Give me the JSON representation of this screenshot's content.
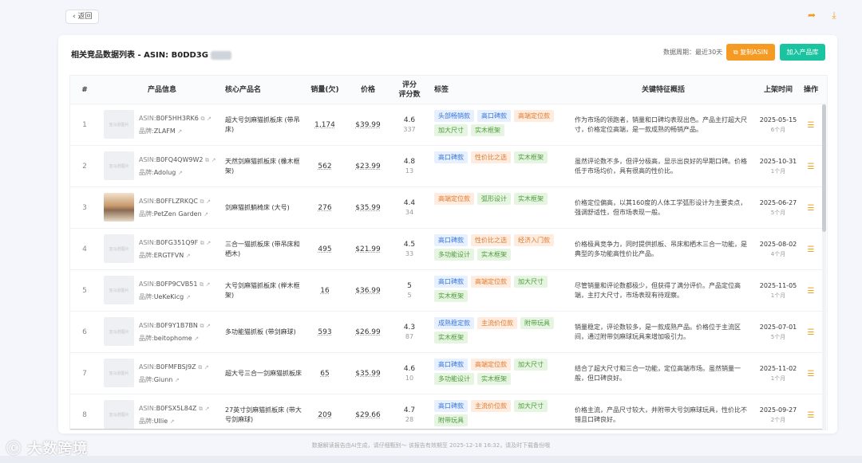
{
  "topbar": {
    "back_label": "返回",
    "share_icon": "share-arrow-icon",
    "download_icon": "download-icon"
  },
  "card": {
    "title": "相关竞品数据列表 - ASIN: B0DD3G",
    "period": "数据周期：最近30天",
    "copy_button": "复制ASIN",
    "add_button": "加入产品库"
  },
  "table": {
    "headers": {
      "index": "#",
      "product": "产品信息",
      "name": "核心产品名",
      "sales": "销量(欠)",
      "price": "价格",
      "score_line1": "评分",
      "score_line2": "评分数",
      "tags": "标签",
      "features": "关键特征概括",
      "date": "上架时间",
      "op": "操作"
    },
    "asin_prefix": "ASIN:",
    "brand_prefix": "品牌:",
    "thumb_placeholder": "亚马逊图片",
    "rows": [
      {
        "idx": "1",
        "asin": "B0F5HH3RK6",
        "brand": "ZLAFM",
        "name": "超大号剑麻猫抓板床 (带吊床)",
        "sales": "1,174",
        "price": "$39.99",
        "score": "4.6",
        "count": "337",
        "tags": [
          {
            "t": "头部畅销款",
            "c": "blue"
          },
          {
            "t": "高口碑款",
            "c": "blue"
          },
          {
            "t": "高端定位款",
            "c": "orange"
          },
          {
            "t": "加大尺寸",
            "c": "green"
          },
          {
            "t": "实木框架",
            "c": "green"
          }
        ],
        "feature": "作为市场的领跑者，销量和口碑均表现出色。产品主打超大尺寸，价格定位高端，是一款成熟的畅销产品。",
        "date": "2025-05-15",
        "ago": "6个月",
        "photo": false
      },
      {
        "idx": "2",
        "asin": "B0FQ4QW9W2",
        "brand": "Adolug",
        "name": "天然剑麻猫抓板床 (橡木框架)",
        "sales": "562",
        "price": "$23.99",
        "score": "4.8",
        "count": "13",
        "tags": [
          {
            "t": "高口碑款",
            "c": "blue"
          },
          {
            "t": "性价比之选",
            "c": "orange"
          },
          {
            "t": "实木框架",
            "c": "green"
          }
        ],
        "feature": "虽然评论数不多，但评分极高，显示出良好的早期口碑。价格低于市场均价，具有很高的性价比。",
        "date": "2025-10-31",
        "ago": "1个月",
        "photo": false
      },
      {
        "idx": "3",
        "asin": "B0FFLZRKQC",
        "brand": "PetZen Garden",
        "name": "剑麻猫抓躺椅床 (大号)",
        "sales": "276",
        "price": "$35.99",
        "score": "4.4",
        "count": "34",
        "tags": [
          {
            "t": "高端定位款",
            "c": "orange"
          },
          {
            "t": "弧形设计",
            "c": "green"
          },
          {
            "t": "实木框架",
            "c": "green"
          }
        ],
        "feature": "价格定位偏高，以其160度的人体工学弧形设计为主要卖点，强调舒适性，但市场表现一般。",
        "date": "2025-06-27",
        "ago": "5个月",
        "photo": true
      },
      {
        "idx": "4",
        "asin": "B0FG351Q9F",
        "brand": "ERGTFVN",
        "name": "三合一猫抓板床 (带吊床和栖木)",
        "sales": "495",
        "price": "$21.99",
        "score": "4.5",
        "count": "33",
        "tags": [
          {
            "t": "高口碑款",
            "c": "blue"
          },
          {
            "t": "性价比之选",
            "c": "orange"
          },
          {
            "t": "经济入门款",
            "c": "orange"
          },
          {
            "t": "多功能设计",
            "c": "green"
          },
          {
            "t": "实木框架",
            "c": "green"
          }
        ],
        "feature": "价格极具竞争力，同时提供抓板、吊床和栖木三合一功能，是典型的多功能高性价比产品。",
        "date": "2025-08-02",
        "ago": "4个月",
        "photo": false
      },
      {
        "idx": "5",
        "asin": "B0FP9CVB51",
        "brand": "UeKeKicg",
        "name": "大号剑麻猫抓板床 (榉木框架)",
        "sales": "16",
        "price": "$36.99",
        "score": "5",
        "count": "5",
        "tags": [
          {
            "t": "高口碑款",
            "c": "blue"
          },
          {
            "t": "高端定位款",
            "c": "orange"
          },
          {
            "t": "加大尺寸",
            "c": "green"
          },
          {
            "t": "实木框架",
            "c": "green"
          }
        ],
        "feature": "尽管销量和评论数都极少，但获得了满分评价。产品定位高端，主打大尺寸，市场表现有待观察。",
        "date": "2025-11-05",
        "ago": "1个月",
        "photo": false
      },
      {
        "idx": "6",
        "asin": "B0F9Y1B7BN",
        "brand": "beitophome",
        "name": "多功能猫抓板 (带剑麻球)",
        "sales": "593",
        "price": "$26.99",
        "score": "4.3",
        "count": "87",
        "tags": [
          {
            "t": "成熟稳定款",
            "c": "blue"
          },
          {
            "t": "主流价位款",
            "c": "orange"
          },
          {
            "t": "附带玩具",
            "c": "green"
          },
          {
            "t": "实木框架",
            "c": "green"
          }
        ],
        "feature": "销量稳定，评论数较多，是一款成熟产品。价格位于主流区间，通过附带剑麻球玩具来增加吸引力。",
        "date": "2025-07-01",
        "ago": "5个月",
        "photo": false
      },
      {
        "idx": "7",
        "asin": "B0FMFBSJ9Z",
        "brand": "Giunn",
        "name": "超大号三合一剑麻猫抓板床",
        "sales": "65",
        "price": "$35.99",
        "score": "4.6",
        "count": "10",
        "tags": [
          {
            "t": "高口碑款",
            "c": "blue"
          },
          {
            "t": "高端定位款",
            "c": "orange"
          },
          {
            "t": "加大尺寸",
            "c": "green"
          },
          {
            "t": "多功能设计",
            "c": "green"
          },
          {
            "t": "实木框架",
            "c": "green"
          }
        ],
        "feature": "结合了超大尺寸和三合一功能，定位高端市场。虽然销量一般，但口碑良好。",
        "date": "2025-11-02",
        "ago": "1个月",
        "photo": false
      },
      {
        "idx": "8",
        "asin": "B0FSX5L84Z",
        "brand": "Ullie",
        "name": "27英寸剑麻猫抓板床 (带大号剑麻球)",
        "sales": "209",
        "price": "$29.66",
        "score": "4.7",
        "count": "28",
        "tags": [
          {
            "t": "高口碑款",
            "c": "blue"
          },
          {
            "t": "主流价位款",
            "c": "orange"
          },
          {
            "t": "加大尺寸",
            "c": "green"
          },
          {
            "t": "附带玩具",
            "c": "green"
          }
        ],
        "feature": "价格主流，产品尺寸较大，并附带大号剑麻球玩具，性价比不错且口碑良好。",
        "date": "2025-09-27",
        "ago": "2个月",
        "photo": false
      }
    ]
  },
  "footer": "数据解读报告由AI生成，请仔细甄别～ 该报告有效期至 2025-12-18 16:32，请及时下载备份哦",
  "watermark": "大数跨境"
}
